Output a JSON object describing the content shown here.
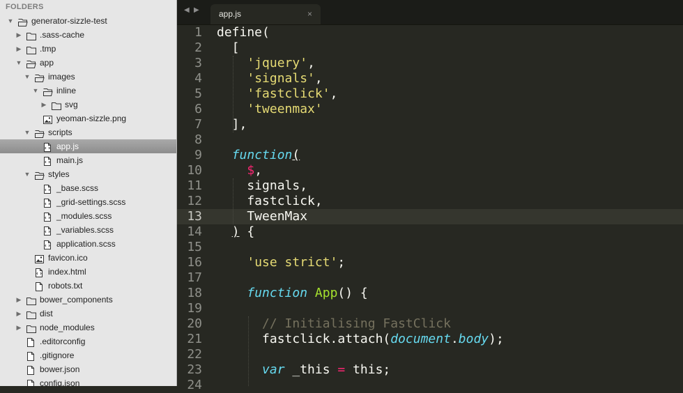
{
  "sidebar": {
    "header": "FOLDERS",
    "items": [
      {
        "label": "generator-sizzle-test",
        "depth": 0,
        "kind": "folder",
        "expanded": true
      },
      {
        "label": ".sass-cache",
        "depth": 1,
        "kind": "folder",
        "expanded": false
      },
      {
        "label": ".tmp",
        "depth": 1,
        "kind": "folder",
        "expanded": false
      },
      {
        "label": "app",
        "depth": 1,
        "kind": "folder",
        "expanded": true
      },
      {
        "label": "images",
        "depth": 2,
        "kind": "folder",
        "expanded": true
      },
      {
        "label": "inline",
        "depth": 3,
        "kind": "folder",
        "expanded": true
      },
      {
        "label": "svg",
        "depth": 4,
        "kind": "folder",
        "expanded": false
      },
      {
        "label": "yeoman-sizzle.png",
        "depth": 3,
        "kind": "image"
      },
      {
        "label": "scripts",
        "depth": 2,
        "kind": "folder",
        "expanded": true
      },
      {
        "label": "app.js",
        "depth": 3,
        "kind": "code",
        "selected": true
      },
      {
        "label": "main.js",
        "depth": 3,
        "kind": "code"
      },
      {
        "label": "styles",
        "depth": 2,
        "kind": "folder",
        "expanded": true
      },
      {
        "label": "_base.scss",
        "depth": 3,
        "kind": "code"
      },
      {
        "label": "_grid-settings.scss",
        "depth": 3,
        "kind": "code"
      },
      {
        "label": "_modules.scss",
        "depth": 3,
        "kind": "code"
      },
      {
        "label": "_variables.scss",
        "depth": 3,
        "kind": "code"
      },
      {
        "label": "application.scss",
        "depth": 3,
        "kind": "code"
      },
      {
        "label": "favicon.ico",
        "depth": 2,
        "kind": "image"
      },
      {
        "label": "index.html",
        "depth": 2,
        "kind": "code"
      },
      {
        "label": "robots.txt",
        "depth": 2,
        "kind": "file"
      },
      {
        "label": "bower_components",
        "depth": 1,
        "kind": "folder",
        "expanded": false
      },
      {
        "label": "dist",
        "depth": 1,
        "kind": "folder",
        "expanded": false
      },
      {
        "label": "node_modules",
        "depth": 1,
        "kind": "folder",
        "expanded": false
      },
      {
        "label": ".editorconfig",
        "depth": 1,
        "kind": "file"
      },
      {
        "label": ".gitignore",
        "depth": 1,
        "kind": "file"
      },
      {
        "label": "bower.json",
        "depth": 1,
        "kind": "file"
      },
      {
        "label": "config.json",
        "depth": 1,
        "kind": "file"
      }
    ]
  },
  "tabs": {
    "back_icon": "left-triangle-icon",
    "forward_icon": "right-triangle-icon",
    "active": {
      "label": "app.js",
      "close_icon": "close-icon",
      "close_glyph": "×"
    }
  },
  "editor": {
    "current_line": 13,
    "lines": [
      {
        "n": "1",
        "tokens": [
          [
            "define(",
            "pl"
          ]
        ]
      },
      {
        "n": "2",
        "tokens": [
          [
            "  [",
            "pl"
          ]
        ]
      },
      {
        "n": "3",
        "tokens": [
          [
            "    ",
            "pl"
          ],
          [
            "'jquery'",
            "str"
          ],
          [
            ",",
            "pl"
          ]
        ]
      },
      {
        "n": "4",
        "tokens": [
          [
            "    ",
            "pl"
          ],
          [
            "'signals'",
            "str"
          ],
          [
            ",",
            "pl"
          ]
        ]
      },
      {
        "n": "5",
        "tokens": [
          [
            "    ",
            "pl"
          ],
          [
            "'fastclick'",
            "str"
          ],
          [
            ",",
            "pl"
          ]
        ]
      },
      {
        "n": "6",
        "tokens": [
          [
            "    ",
            "pl"
          ],
          [
            "'tweenmax'",
            "str"
          ]
        ]
      },
      {
        "n": "7",
        "tokens": [
          [
            "  ],",
            "pl"
          ]
        ]
      },
      {
        "n": "8",
        "tokens": []
      },
      {
        "n": "9",
        "tokens": [
          [
            "  ",
            "pl"
          ],
          [
            "function",
            "kw"
          ],
          [
            "(",
            "ul"
          ]
        ]
      },
      {
        "n": "10",
        "tokens": [
          [
            "    ",
            "pl"
          ],
          [
            "$",
            "var"
          ],
          [
            ",",
            "pl"
          ]
        ]
      },
      {
        "n": "11",
        "tokens": [
          [
            "    signals,",
            "pl"
          ]
        ]
      },
      {
        "n": "12",
        "tokens": [
          [
            "    fastclick,",
            "pl"
          ]
        ]
      },
      {
        "n": "13",
        "tokens": [
          [
            "    TweenMax",
            "pl"
          ]
        ]
      },
      {
        "n": "14",
        "tokens": [
          [
            "  ",
            "pl"
          ],
          [
            ")",
            "ul"
          ],
          [
            " {",
            "pl"
          ]
        ]
      },
      {
        "n": "15",
        "tokens": []
      },
      {
        "n": "16",
        "tokens": [
          [
            "    ",
            "pl"
          ],
          [
            "'use strict'",
            "str"
          ],
          [
            ";",
            "pl"
          ]
        ]
      },
      {
        "n": "17",
        "tokens": []
      },
      {
        "n": "18",
        "tokens": [
          [
            "    ",
            "pl"
          ],
          [
            "function",
            "kw"
          ],
          [
            " ",
            "pl"
          ],
          [
            "App",
            "fn"
          ],
          [
            "() {",
            "pl"
          ]
        ]
      },
      {
        "n": "19",
        "tokens": []
      },
      {
        "n": "20",
        "tokens": [
          [
            "      ",
            "pl"
          ],
          [
            "// Initialising FastClick",
            "cm"
          ]
        ]
      },
      {
        "n": "21",
        "tokens": [
          [
            "      fastclick.attach(",
            "pl"
          ],
          [
            "document",
            "it"
          ],
          [
            ".",
            "pl"
          ],
          [
            "body",
            "it"
          ],
          [
            ");",
            "pl"
          ]
        ]
      },
      {
        "n": "22",
        "tokens": []
      },
      {
        "n": "23",
        "tokens": [
          [
            "      ",
            "pl"
          ],
          [
            "var",
            "kw"
          ],
          [
            " _this ",
            "pl"
          ],
          [
            "=",
            "var"
          ],
          [
            " this;",
            "pl"
          ]
        ]
      },
      {
        "n": "24",
        "tokens": []
      }
    ]
  },
  "colors": {
    "editor_bg": "#272822",
    "sidebar_bg": "#e6e6e6",
    "string": "#e6db74",
    "keyword": "#66d9ef",
    "operator": "#f92672",
    "function": "#a6e22e",
    "comment": "#75715e"
  }
}
